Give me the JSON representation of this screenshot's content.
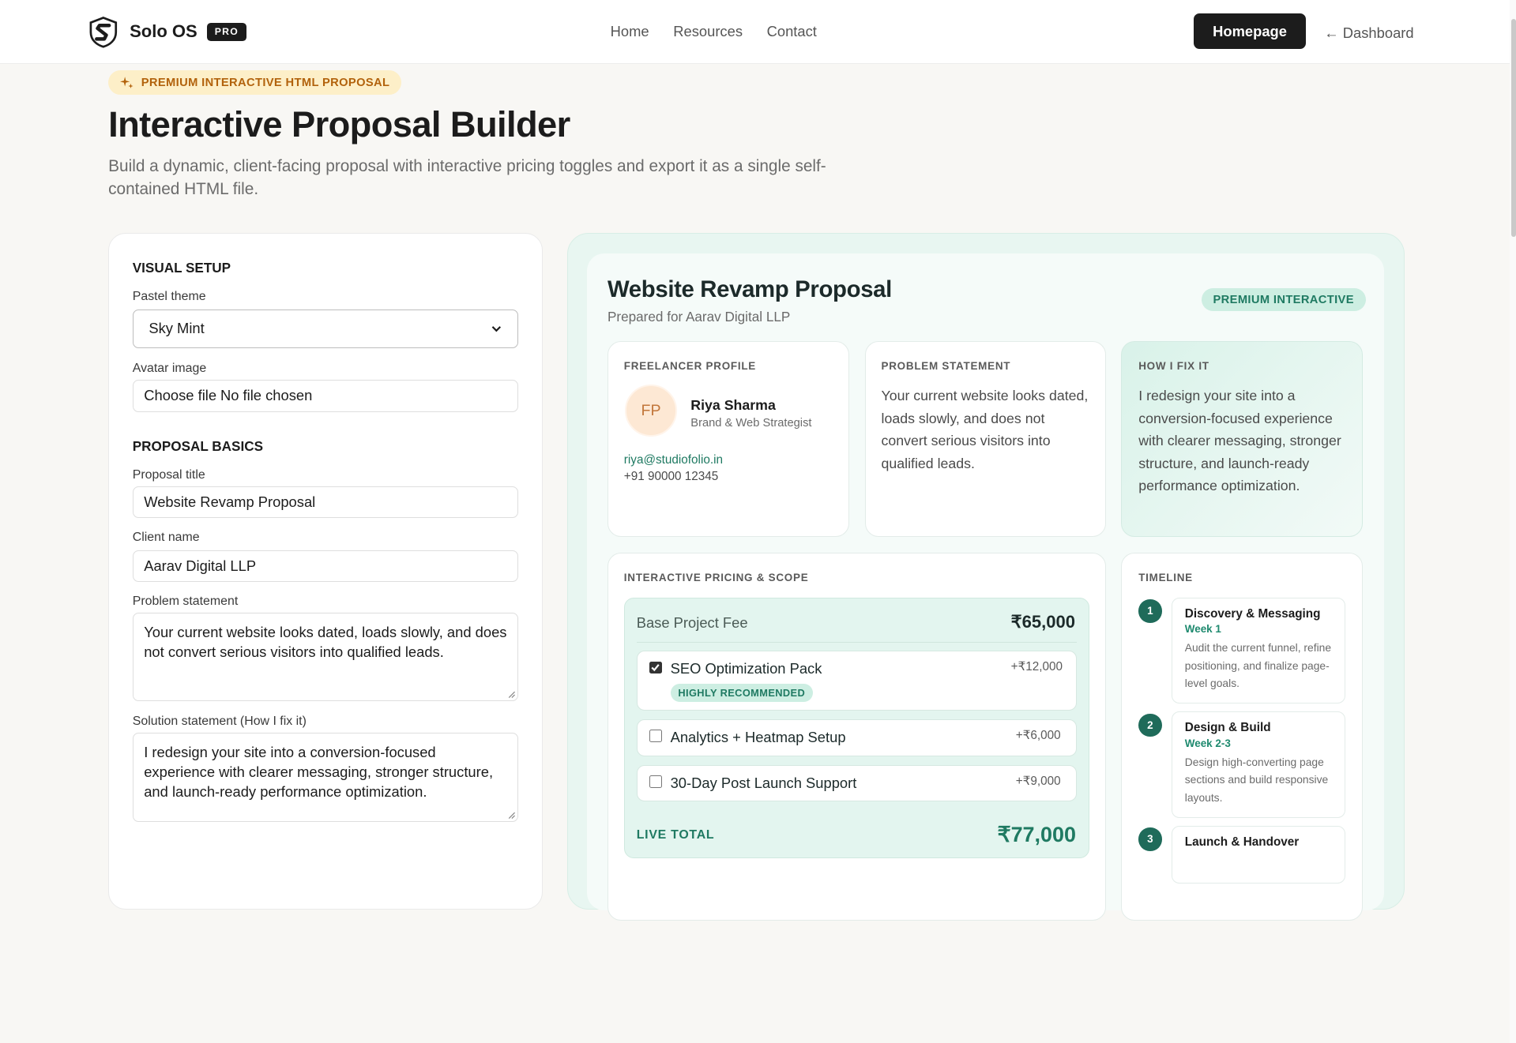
{
  "header": {
    "brand": "Solo OS",
    "badge": "PRO",
    "nav": [
      "Home",
      "Resources",
      "Contact"
    ],
    "homepage_button": "Homepage",
    "dashboard_link": "← Dashboard"
  },
  "hero": {
    "pill": "PREMIUM INTERACTIVE HTML PROPOSAL",
    "title": "Interactive Proposal Builder",
    "subtitle": "Build a dynamic, client-facing proposal with interactive pricing toggles and export it as a single self-contained HTML file."
  },
  "form": {
    "visual_setup_heading": "VISUAL SETUP",
    "theme_label": "Pastel theme",
    "theme_value": "Sky Mint",
    "avatar_label": "Avatar image",
    "avatar_choose": "Choose file",
    "avatar_status": "No file chosen",
    "basics_heading": "PROPOSAL BASICS",
    "title_label": "Proposal title",
    "title_value": "Website Revamp Proposal",
    "client_label": "Client name",
    "client_value": "Aarav Digital LLP",
    "problem_label": "Problem statement",
    "problem_value": "Your current website looks dated, loads slowly, and does not convert serious visitors into qualified leads.",
    "solution_label": "Solution statement (How I fix it)",
    "solution_value": "I redesign your site into a conversion-focused experience with clearer messaging, stronger structure, and launch-ready performance optimization."
  },
  "preview": {
    "title": "Website Revamp Proposal",
    "prepared_for": "Prepared for Aarav Digital LLP",
    "badge": "PREMIUM INTERACTIVE",
    "freelancer": {
      "heading": "FREELANCER PROFILE",
      "initials": "FP",
      "name": "Riya Sharma",
      "role": "Brand & Web Strategist",
      "email": "riya@studiofolio.in",
      "phone": "+91 90000 12345"
    },
    "problem": {
      "heading": "PROBLEM STATEMENT",
      "body": "Your current website looks dated, loads slowly, and does not convert serious visitors into qualified leads."
    },
    "fix": {
      "heading": "HOW I FIX IT",
      "body": "I redesign your site into a conversion-focused experience with clearer messaging, stronger structure, and launch-ready performance optimization."
    },
    "pricing": {
      "heading": "INTERACTIVE PRICING & SCOPE",
      "base_label": "Base Project Fee",
      "base_value": "₹65,000",
      "addons": [
        {
          "name": "SEO Optimization Pack",
          "price": "+₹12,000",
          "checked": true,
          "tag": "HIGHLY RECOMMENDED"
        },
        {
          "name": "Analytics + Heatmap Setup",
          "price": "+₹6,000",
          "checked": false
        },
        {
          "name": "30-Day Post Launch Support",
          "price": "+₹9,000",
          "checked": false
        }
      ],
      "live_label": "LIVE TOTAL",
      "live_value": "₹77,000"
    },
    "timeline": {
      "heading": "TIMELINE",
      "steps": [
        {
          "num": "1",
          "title": "Discovery & Messaging",
          "week": "Week 1",
          "desc": "Audit the current funnel, refine positioning, and finalize page-level goals."
        },
        {
          "num": "2",
          "title": "Design & Build",
          "week": "Week 2-3",
          "desc": "Design high-converting page sections and build responsive layouts."
        },
        {
          "num": "3",
          "title": "Launch & Handover",
          "week": "",
          "desc": ""
        }
      ]
    }
  },
  "colors": {
    "accent": "#1f7a62",
    "dark": "#1c1c1c",
    "mint_bg": "#e8f6f1",
    "pill_bg": "#fdefc8",
    "pill_text": "#b2620c"
  }
}
